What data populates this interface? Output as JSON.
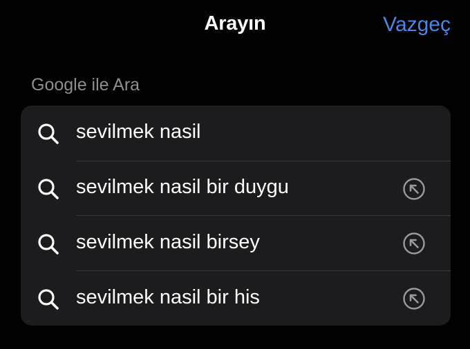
{
  "nav": {
    "title": "Arayın",
    "cancel_label": "Vazgeç"
  },
  "section": {
    "header": "Google ile Ara"
  },
  "suggestions": [
    {
      "label": "sevilmek nasil",
      "icon": "search-icon",
      "has_fill_arrow": false
    },
    {
      "label": "sevilmek nasil bir duygu",
      "icon": "search-icon",
      "has_fill_arrow": true
    },
    {
      "label": "sevilmek nasil birsey",
      "icon": "search-icon",
      "has_fill_arrow": true
    },
    {
      "label": "sevilmek nasil bir his",
      "icon": "search-icon",
      "has_fill_arrow": true
    }
  ],
  "colors": {
    "background": "#000000",
    "card": "#1c1c1e",
    "accent": "#4a86e8",
    "secondary_text": "#8e8e93",
    "separator": "#38383a"
  }
}
